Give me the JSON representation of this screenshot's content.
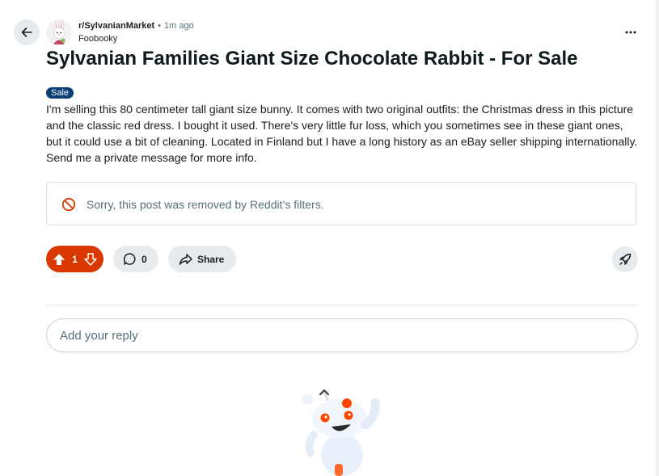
{
  "header": {
    "subreddit": "r/SylvanianMarket",
    "separator": "•",
    "time_ago": "1m ago",
    "author": "Foobooky"
  },
  "post": {
    "title": "Sylvanian Families Giant Size Chocolate Rabbit - For Sale",
    "flair": "Sale",
    "body": "I'm selling this 80 centimeter tall giant size bunny. It comes with two original outfits: the Christmas dress in this picture and the classic red dress. I bought it used. There's very little fur loss, which you sometimes see in these giant ones, but it could use a bit of cleaning. Located in Finland but I have a long history as an eBay seller shipping internationally. Send me a private message for more info.",
    "removed_notice": "Sorry, this post was removed by Reddit’s filters."
  },
  "actions": {
    "vote_count": "1",
    "comment_count": "0",
    "share_label": "Share",
    "vote_color": "#d93900"
  },
  "reply": {
    "placeholder": "Add your reply"
  },
  "icons": {
    "back": "arrow-left-icon",
    "more": "more-horizontal-icon",
    "removed": "prohibited-icon",
    "upvote": "arrow-up-icon",
    "downvote": "arrow-down-icon",
    "comment": "comment-bubble-icon",
    "share": "share-arrow-icon",
    "award": "rocket-icon"
  }
}
